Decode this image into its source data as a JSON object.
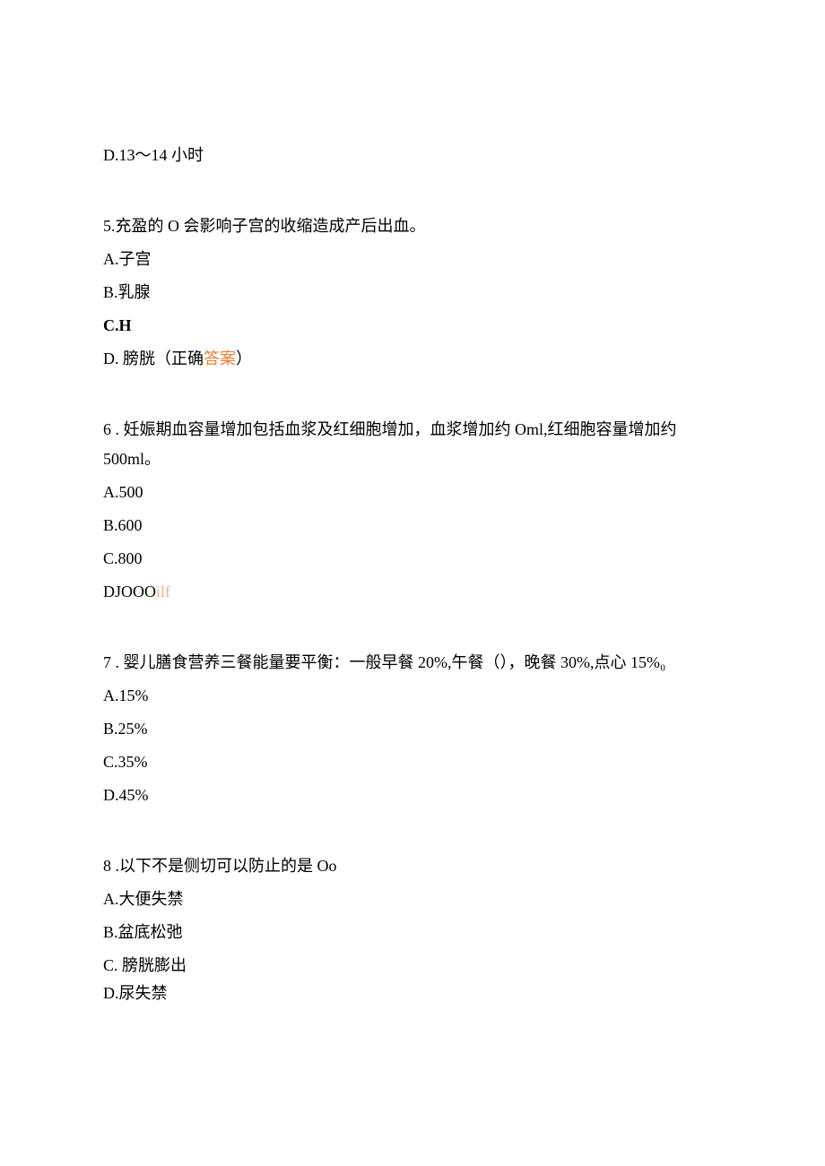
{
  "q4": {
    "optD": "D.13～14 小时"
  },
  "q5": {
    "stem": "5.充盈的 O 会影响子宫的收缩造成产后出血。",
    "optA": "A.子宫",
    "optB": "B.乳腺",
    "optC": "C.H",
    "optD_prefix": "D. 膀胱（正确",
    "optD_ans": "答案",
    "optD_suffix": "）"
  },
  "q6": {
    "stem_line1": "6  . 妊娠期血容量增加包括血浆及红细胞增加，血浆增加约 Oml,红细胞容量增加约",
    "stem_line2": "500ml。",
    "optA": "A.500",
    "optB": "B.600",
    "optC": "C.800",
    "optD_prefix": "DJOOO",
    "optD_ans": "ilf"
  },
  "q7": {
    "stem": "7  . 婴儿膳食营养三餐能量要平衡：一般早餐 20%,午餐（），晚餐 30%,点心 15%₀",
    "optA": "A.15%",
    "optB": "B.25%",
    "optC": "C.35%",
    "optD": "D.45%"
  },
  "q8": {
    "stem": "8  .以下不是侧切可以防止的是 Oo",
    "optA": "A.大便失禁",
    "optB": "B.盆底松弛",
    "optC": "C. 膀胱膨出",
    "optD": "D.尿失禁"
  }
}
